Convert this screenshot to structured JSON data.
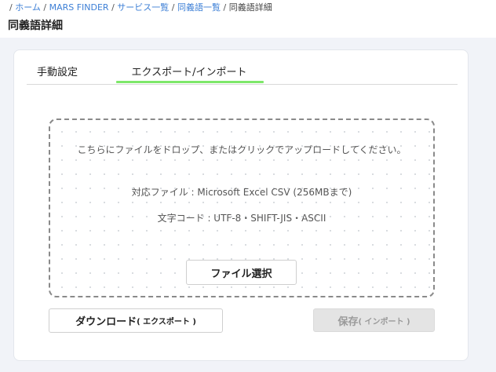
{
  "breadcrumb": {
    "lead": "/ ",
    "items": [
      "ホーム",
      "MARS FINDER",
      "サービス一覧",
      "同義語一覧"
    ],
    "separator": " / ",
    "current": "同義語詳細"
  },
  "page": {
    "title": "同義語詳細"
  },
  "tabs": [
    {
      "label": "手動設定",
      "active": false
    },
    {
      "label": "エクスポート/インポート",
      "active": true
    }
  ],
  "dropzone": {
    "instruction": "こちらにファイルをドロップ、またはクリックでアップロードしてください。",
    "format": "対応ファイル : Microsoft Excel CSV (256MBまで)",
    "encoding": "文字コード : UTF-8・SHIFT-JIS・ASCII",
    "file_button": "ファイル選択"
  },
  "actions": {
    "download_label": "ダウンロード",
    "download_sub": "( エクスポート )",
    "save_label": "保存",
    "save_sub": "( インポート )",
    "save_enabled": false
  },
  "colors": {
    "link": "#3d7fd6",
    "active_tab_underline": "#7ee86a",
    "background": "#f1f3f8",
    "disabled_button": "#e4e4e4"
  }
}
